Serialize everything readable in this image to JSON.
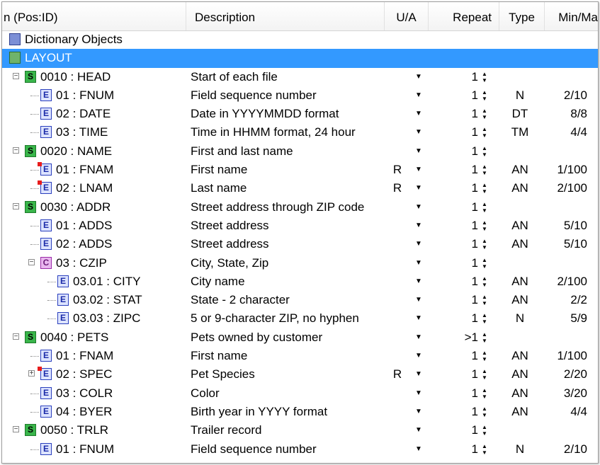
{
  "header": {
    "name": "n (Pos:ID)",
    "description": "Description",
    "ua": "U/A",
    "repeat": "Repeat",
    "type": "Type",
    "minmax": "Min/Ma"
  },
  "icons": {
    "dropdown": "▼",
    "spinner": "▲▼"
  },
  "rows": [
    {
      "label": "Dictionary Objects",
      "icon": "dictionary-icon",
      "badge": "D",
      "level": 0
    },
    {
      "label": "LAYOUT",
      "icon": "layout-icon",
      "badge": "L",
      "level": 0,
      "selected": true
    },
    {
      "label": "0010 : HEAD",
      "badge": "S",
      "level": 1,
      "desc": "Start of each file",
      "ua": "",
      "repeat": "1",
      "type": "",
      "mm": ""
    },
    {
      "label": "01 : FNUM",
      "badge": "E",
      "level": 2,
      "desc": "Field sequence number",
      "ua": "",
      "repeat": "1",
      "type": "N",
      "mm": "2/10"
    },
    {
      "label": "02 : DATE",
      "badge": "E",
      "level": 2,
      "desc": "Date in YYYYMMDD format",
      "ua": "",
      "repeat": "1",
      "type": "DT",
      "mm": "8/8"
    },
    {
      "label": "03 : TIME",
      "badge": "E",
      "level": 2,
      "desc": "Time in HHMM format, 24 hour",
      "ua": "",
      "repeat": "1",
      "type": "TM",
      "mm": "4/4"
    },
    {
      "label": "0020 : NAME",
      "badge": "S",
      "level": 1,
      "desc": "First and last name",
      "ua": "",
      "repeat": "1",
      "type": "",
      "mm": ""
    },
    {
      "label": "01 : FNAM",
      "badge": "E",
      "level": 2,
      "flag": true,
      "desc": "First name",
      "ua": "R",
      "repeat": "1",
      "type": "AN",
      "mm": "1/100"
    },
    {
      "label": "02 : LNAM",
      "badge": "E",
      "level": 2,
      "flag": true,
      "desc": "Last name",
      "ua": "R",
      "repeat": "1",
      "type": "AN",
      "mm": "2/100"
    },
    {
      "label": "0030 : ADDR",
      "badge": "S",
      "level": 1,
      "desc": "Street address through ZIP code",
      "ua": "",
      "repeat": "1",
      "type": "",
      "mm": ""
    },
    {
      "label": "01 : ADDS",
      "badge": "E",
      "level": 2,
      "desc": "Street address",
      "ua": "",
      "repeat": "1",
      "type": "AN",
      "mm": "5/10"
    },
    {
      "label": "02 : ADDS",
      "badge": "E",
      "level": 2,
      "desc": "Street address",
      "ua": "",
      "repeat": "1",
      "type": "AN",
      "mm": "5/10"
    },
    {
      "label": "03 : CZIP",
      "badge": "C",
      "level": 2,
      "desc": "City, State, Zip",
      "ua": "",
      "repeat": "1",
      "type": "",
      "mm": ""
    },
    {
      "label": "03.01 : CITY",
      "badge": "E",
      "level": 3,
      "desc": "City name",
      "ua": "",
      "repeat": "1",
      "type": "AN",
      "mm": "2/100"
    },
    {
      "label": "03.02 : STAT",
      "badge": "E",
      "level": 3,
      "desc": "State - 2 character",
      "ua": "",
      "repeat": "1",
      "type": "AN",
      "mm": "2/2"
    },
    {
      "label": "03.03 : ZIPC",
      "badge": "E",
      "level": 3,
      "desc": "5 or 9-character ZIP, no hyphen",
      "ua": "",
      "repeat": "1",
      "type": "N",
      "mm": "5/9"
    },
    {
      "label": "0040 : PETS",
      "badge": "S",
      "level": 1,
      "desc": "Pets owned by customer",
      "ua": "",
      "repeat": ">1",
      "type": "",
      "mm": ""
    },
    {
      "label": "01 : FNAM",
      "badge": "E",
      "level": 2,
      "desc": "First name",
      "ua": "",
      "repeat": "1",
      "type": "AN",
      "mm": "1/100"
    },
    {
      "label": "02 : SPEC",
      "badge": "E",
      "level": 2,
      "flag": true,
      "expander": true,
      "desc": "Pet Species",
      "ua": "R",
      "repeat": "1",
      "type": "AN",
      "mm": "2/20"
    },
    {
      "label": "03 : COLR",
      "badge": "E",
      "level": 2,
      "desc": "Color",
      "ua": "",
      "repeat": "1",
      "type": "AN",
      "mm": "3/20"
    },
    {
      "label": "04 : BYER",
      "badge": "E",
      "level": 2,
      "desc": "Birth year in YYYY format",
      "ua": "",
      "repeat": "1",
      "type": "AN",
      "mm": "4/4"
    },
    {
      "label": "0050 : TRLR",
      "badge": "S",
      "level": 1,
      "desc": "Trailer record",
      "ua": "",
      "repeat": "1",
      "type": "",
      "mm": ""
    },
    {
      "label": "01 : FNUM",
      "badge": "E",
      "level": 2,
      "desc": "Field sequence number",
      "ua": "",
      "repeat": "1",
      "type": "N",
      "mm": "2/10"
    }
  ]
}
